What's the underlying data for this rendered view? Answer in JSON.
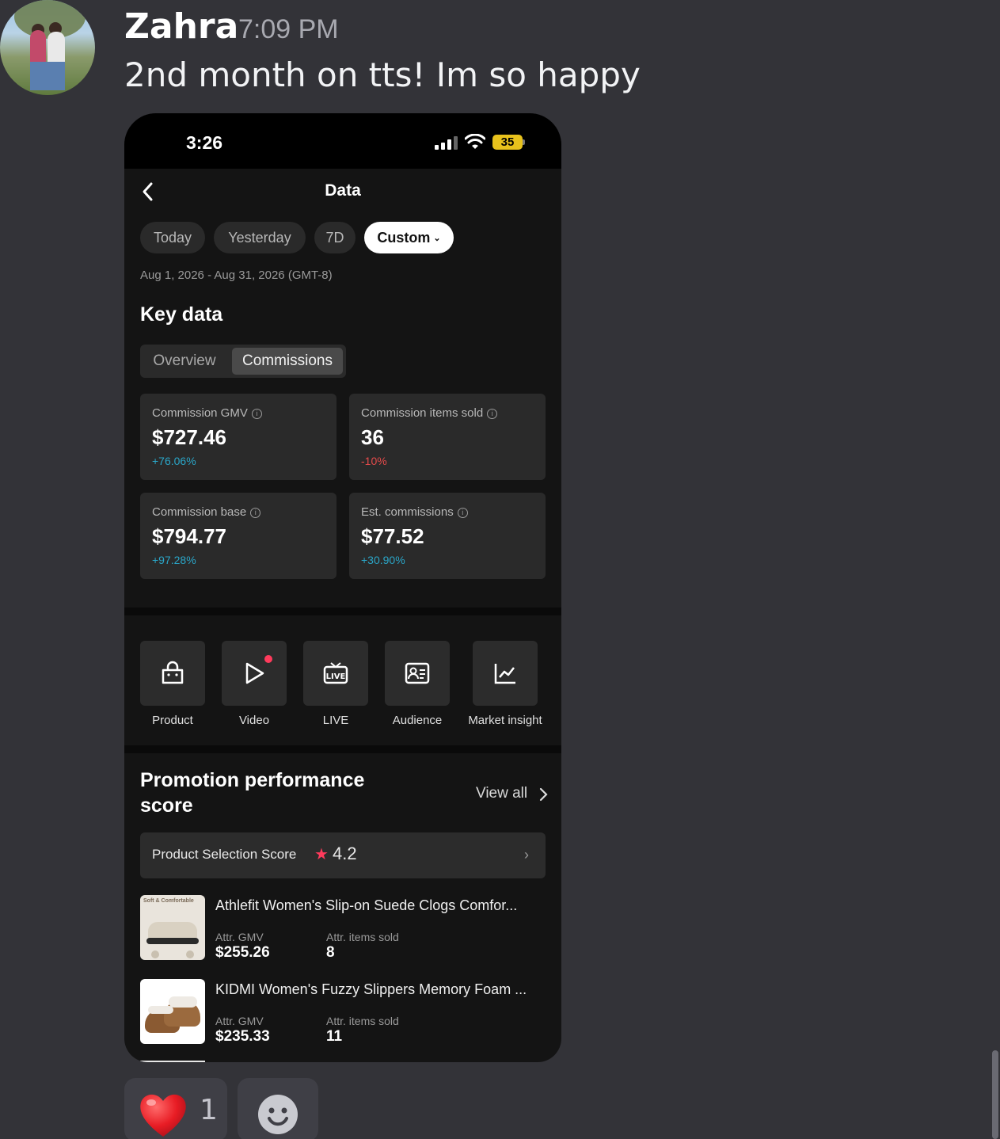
{
  "message": {
    "username": "Zahra",
    "timestamp": "7:09 PM",
    "text": "2nd month on tts! Im so happy"
  },
  "phone": {
    "status_time": "3:26",
    "battery": "35",
    "header_title": "Data",
    "chips": [
      "Today",
      "Yesterday",
      "7D",
      "Custom"
    ],
    "active_chip": "Custom",
    "date_range": "Aug 1, 2026 - Aug 31, 2026 (GMT-8)",
    "key_data_title": "Key data",
    "tabs": [
      "Overview",
      "Commissions"
    ],
    "active_tab": "Commissions",
    "metrics": [
      {
        "label": "Commission GMV",
        "value": "$727.46",
        "delta": "+76.06%",
        "trend": "up"
      },
      {
        "label": "Commission items sold",
        "value": "36",
        "delta": "-10%",
        "trend": "down"
      },
      {
        "label": "Commission base",
        "value": "$794.77",
        "delta": "+97.28%",
        "trend": "up"
      },
      {
        "label": "Est. commissions",
        "value": "$77.52",
        "delta": "+30.90%",
        "trend": "up"
      }
    ],
    "tools": [
      {
        "label": "Product",
        "icon": "shopping-bag-icon"
      },
      {
        "label": "Video",
        "icon": "play-icon"
      },
      {
        "label": "LIVE",
        "icon": "live-tv-icon"
      },
      {
        "label": "Audience",
        "icon": "id-card-icon"
      },
      {
        "label": "Market insight",
        "icon": "line-chart-icon"
      }
    ],
    "promo_title": "Promotion performance score",
    "view_all": "View all",
    "pss_label": "Product Selection Score",
    "pss_score": "4.2",
    "products": [
      {
        "title": "Athlefit Women's Slip-on Suede Clogs Comfor...",
        "image_caption": "Soft & Comfortable",
        "gmv_label": "Attr. GMV",
        "gmv": "$255.26",
        "sold_label": "Attr. items sold",
        "sold": "8"
      },
      {
        "title": "KIDMI Women's Fuzzy Slippers Memory Foam ...",
        "gmv_label": "Attr. GMV",
        "gmv": "$235.33",
        "sold_label": "Attr. items sold",
        "sold": "11"
      }
    ]
  },
  "reactions": {
    "heart_count": "1"
  },
  "colors": {
    "background": "#333338",
    "positive": "#2aa6c8",
    "negative": "#e54b4b",
    "accent_red": "#ff3b5c"
  }
}
